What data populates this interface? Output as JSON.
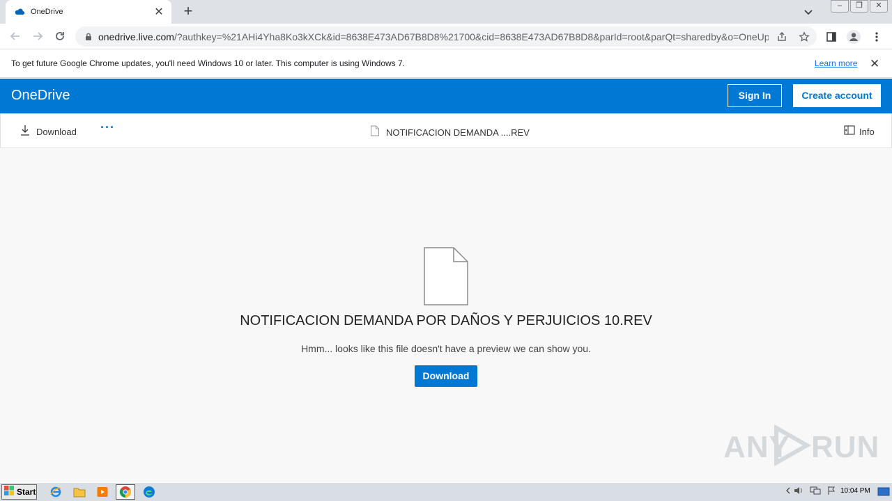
{
  "browser": {
    "tab_title": "OneDrive",
    "tab_close": "✕",
    "new_tab": "+",
    "url_host": "onedrive.live.com",
    "url_rest": "/?authkey=%21AHi4Yha8Ko3kXCk&id=8638E473AD67B8D8%21700&cid=8638E473AD67B8D8&parId=root&parQt=sharedby&o=OneUp",
    "window_buttons": [
      "–",
      "❐",
      "✕"
    ]
  },
  "infobar": {
    "message": "To get future Google Chrome updates, you'll need Windows 10 or later. This computer is using Windows 7.",
    "learn_more": "Learn more",
    "close": "✕"
  },
  "onedrive": {
    "brand": "OneDrive",
    "sign_in": "Sign In",
    "create_account": "Create account"
  },
  "commandbar": {
    "download": "Download",
    "more": "···",
    "file_name": "NOTIFICACION DEMANDA ....REV",
    "info": "Info"
  },
  "content": {
    "file_title": "NOTIFICACION DEMANDA POR DAÑOS Y PERJUICIOS 10.REV",
    "no_preview": "Hmm... looks like this file doesn't have a preview we can show you.",
    "download_button": "Download"
  },
  "watermark": {
    "text_left": "ANY",
    "text_right": "RUN"
  },
  "taskbar": {
    "start": "Start",
    "clock": "10:04 PM"
  },
  "colors": {
    "onedrive_blue": "#0078d4",
    "chrome_tabstrip": "#dee1e6",
    "page_background": "#f8f8f8"
  }
}
